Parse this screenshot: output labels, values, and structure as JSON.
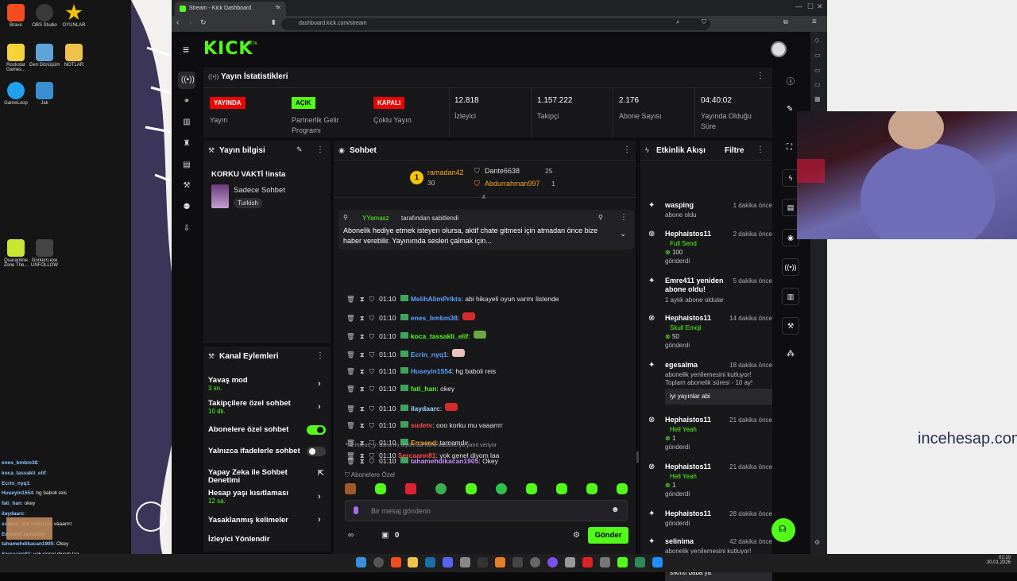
{
  "desktop": {
    "icons": [
      {
        "label": "Brave",
        "color": "#f54b1f"
      },
      {
        "label": "OBS Studio",
        "color": "#3a3a3a"
      },
      {
        "label": "OYUNLAR",
        "color": "#f5c400"
      },
      {
        "label": "Rockstar Games...",
        "color": "#f6d23b"
      },
      {
        "label": "Geri Dönüşüm",
        "color": "#5fa3d8"
      },
      {
        "label": "NOTLAR",
        "color": "#f0c24c"
      },
      {
        "label": "GameLoop",
        "color": "#22a0f0"
      },
      {
        "label": "Jak",
        "color": "#3a8fd0"
      },
      {
        "label": "Quarantine Zone The...",
        "color": "#c6e830"
      },
      {
        "label": "Gorkem.exe UNFOLLOW",
        "color": "#444"
      }
    ]
  },
  "browser": {
    "tab_title": "Stream - Kick Dashboard",
    "url": "dashboard.kick.com/stream"
  },
  "kick": {
    "logo": "KICK",
    "beta": "BETA",
    "stats": {
      "title": "Yayın İstatistikleri",
      "items": [
        {
          "badge": "YAYINDA",
          "badge_color": "#eb0400",
          "label": "Yayın"
        },
        {
          "badge": "AÇIK",
          "badge_color": "#53fc18",
          "label": "Partnerlik Gelir Programı"
        },
        {
          "badge": "KAPALI",
          "badge_color": "#eb0400",
          "label": "Çoklu Yayın"
        },
        {
          "value": "12.818",
          "label": "İzleyici"
        },
        {
          "value": "1.157.222",
          "label": "Takipçi"
        },
        {
          "value": "2.176",
          "label": "Abone Sayısı"
        },
        {
          "value": "04:40:02",
          "label": "Yayında Olduğu Süre"
        }
      ]
    },
    "stream_info": {
      "title": "Yayın bilgisi",
      "stream_title": "KORKU VAKTİ !insta",
      "category": "Sadece Sohbet",
      "tag": "Turkish"
    },
    "channel_actions": {
      "title": "Kanal Eylemleri",
      "rows": [
        {
          "label": "Yavaş mod",
          "sub": "3 sn.",
          "type": "chevron"
        },
        {
          "label": "Takipçilere özel sohbet",
          "sub": "10 dk.",
          "type": "chevron"
        },
        {
          "label": "Abonelere özel sohbet",
          "type": "toggle",
          "on": true
        },
        {
          "label": "Yalnızca ifadelerle sohbet",
          "type": "toggle",
          "on": false
        },
        {
          "label": "Yapay Zeka ile Sohbet Denetimi",
          "type": "external"
        },
        {
          "label": "Hesap yaşı kısıtlaması",
          "sub": "12 sa.",
          "type": "chevron"
        },
        {
          "label": "Yasaklanmış kelimeler",
          "type": "chevron"
        },
        {
          "label": "İzleyici Yönlendir",
          "type": "none"
        }
      ]
    },
    "chat": {
      "title": "Sohbet",
      "leaders": [
        {
          "name": "ramadan42",
          "count": "30"
        },
        {
          "name": "Dante6638",
          "count": "25"
        },
        {
          "name": "Abdurrahman997",
          "count": "1"
        }
      ],
      "pinned": {
        "by_user": "YYamasz",
        "by_text": "tarafından sabitlendi",
        "text": "Abonelik hediye etmek isteyen olursa, aktif chate gitmesi için atmadan önce bize haber verebilir. Yayınımda sesleri çalmak için..."
      },
      "messages": [
        {
          "time": "01:10",
          "user": "MelihAlimPrlkts",
          "color": "#5aa0ff",
          "text": ": abi hikayeli oyun varmı listende"
        },
        {
          "time": "01:10",
          "user": "enes_bmbm38",
          "color": "#5aa0ff",
          "text": ":"
        },
        {
          "time": "01:10",
          "user": "koca_tassakli_elif",
          "color": "#53fc18",
          "text": ":"
        },
        {
          "time": "01:10",
          "user": "Ecrin_nyq1",
          "color": "#5aa0ff",
          "text": ":"
        },
        {
          "time": "01:10",
          "user": "Huseyin1554",
          "color": "#5aa0ff",
          "text": ": hg baboli reis"
        },
        {
          "time": "01:10",
          "user": "fati_han",
          "color": "#53fc18",
          "text": ": okey"
        },
        {
          "time": "01:10",
          "user": "ilaydaarc",
          "color": "#9ad3ff",
          "text": ":"
        },
        {
          "time": "01:10",
          "user": "sudetv",
          "color": "#ff4a4a",
          "text": ": ooo korku mu vaaarrrr"
        },
        {
          "time": "01:10",
          "user": "Erraend",
          "color": "#f5a623",
          "text": ": tamamdır"
        },
        {
          "time": "01:10",
          "user": "tahamehdikacan1905",
          "color": "#c58bff",
          "text": ": Okey"
        }
      ],
      "reply_note": "Emreus_y: bana mı diyon laa isimli kullanıcıya yanıt veriyor",
      "last_msg": {
        "time": "01:10",
        "user": "Sercaann81",
        "color": "#ff4a4a",
        "text": ": yok genel diyom laa"
      },
      "sub_label": "Abonelere Özel",
      "input_placeholder": "Bir mesaj gönderin",
      "points": "0",
      "send": "Gönder"
    },
    "activity": {
      "title": "Etkinlik Akışı",
      "filter": "Filtre",
      "items": [
        {
          "name": "wasping",
          "time": "1 dakika önce",
          "sub": "abone oldu"
        },
        {
          "name": "Hephaistos11",
          "time": "2 dakika önce",
          "badge": "Full Send",
          "amount": "100",
          "sub": "gönderdi"
        },
        {
          "name": "Emre411 yeniden abone oldu!",
          "time": "5 dakika önce",
          "sub": "1 aylık abone oldular"
        },
        {
          "name": "Hephaistos11",
          "time": "14 dakika önce",
          "badge": "Skull Emoji",
          "amount": "50",
          "sub": "gönderdi"
        },
        {
          "name": "egesalma",
          "time": "18 dakika önce",
          "sub": "abonelik yenilemesini kutluyor! Toplam abonelik süresi - 10 ay!",
          "msg": "iyi yayınlar abi"
        },
        {
          "name": "Hephaistos11",
          "time": "21 dakika önce",
          "badge": "Hell Yeah",
          "amount": "1",
          "sub": "gönderdi"
        },
        {
          "name": "Hephaistos11",
          "time": "21 dakika önce",
          "badge": "Hell Yeah",
          "amount": "1",
          "sub": "gönderdi"
        },
        {
          "name": "Hephaistos11",
          "time": "28 dakika önce",
          "sub": "gönderdi"
        },
        {
          "name": "selinima",
          "time": "42 dakika önce",
          "sub": "abonelik yenilemesini kutluyor! Toplam abonelik süresi - 2 ay!",
          "msg": "sıkıntı baba ya"
        }
      ]
    }
  },
  "overlay": {
    "watermark": "incehesap.com",
    "chat": [
      {
        "user": "enes_bmbm38",
        "text": ":"
      },
      {
        "user": "koca_tassakli_elif",
        "text": ":"
      },
      {
        "user": "Ecrin_nyq1",
        "text": ":"
      },
      {
        "user": "Huseyin1554",
        "text": ": hg baboli reis"
      },
      {
        "user": "fati_han",
        "text": ": okey"
      },
      {
        "user": "ilaydaarc",
        "text": ":"
      },
      {
        "user": "sudetv",
        "text": ": ooo korku mu vaaarrrr"
      },
      {
        "user": "Erraend",
        "text": ": tamamdır"
      },
      {
        "user": "tahamehdikacan1905",
        "text": ": Okey"
      },
      {
        "user": "Sercaann81",
        "text": ": yok genel diyom laa"
      }
    ]
  },
  "taskbar": {
    "time": "01:10",
    "date": "20.01.2026"
  }
}
